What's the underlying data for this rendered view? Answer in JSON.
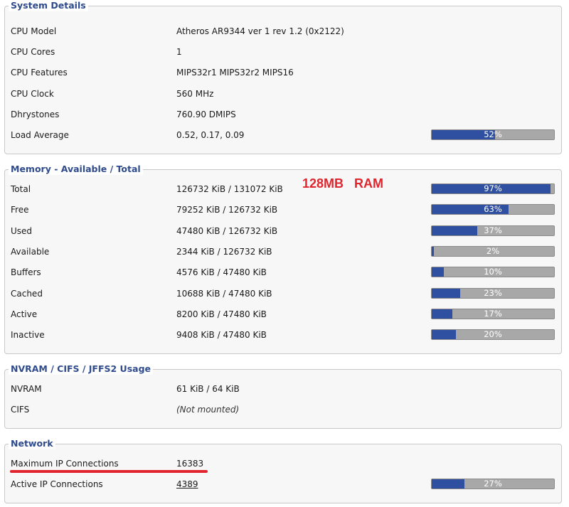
{
  "system": {
    "legend": "System Details",
    "rows": [
      {
        "label": "CPU Model",
        "value": "Atheros AR9344 ver 1 rev 1.2 (0x2122)"
      },
      {
        "label": "CPU Cores",
        "value": "1"
      },
      {
        "label": "CPU Features",
        "value": "MIPS32r1 MIPS32r2 MIPS16"
      },
      {
        "label": "CPU Clock",
        "value": "560 MHz"
      },
      {
        "label": "Dhrystones",
        "value": "760.90 DMIPS"
      },
      {
        "label": "Load Average",
        "value": "0.52, 0.17, 0.09",
        "bar_percent": 52,
        "bar_text": "52%"
      }
    ]
  },
  "memory": {
    "legend": "Memory - Available / Total",
    "annotation": "128MB   RAM",
    "rows": [
      {
        "label": "Total",
        "value": "126732 KiB / 131072 KiB",
        "bar_percent": 97,
        "bar_text": "97%"
      },
      {
        "label": "Free",
        "value": "79252 KiB / 126732 KiB",
        "bar_percent": 63,
        "bar_text": "63%"
      },
      {
        "label": "Used",
        "value": "47480 KiB / 126732 KiB",
        "bar_percent": 37,
        "bar_text": "37%"
      },
      {
        "label": "Available",
        "value": "2344 KiB / 126732 KiB",
        "bar_percent": 2,
        "bar_text": "2%"
      },
      {
        "label": "Buffers",
        "value": "4576 KiB / 47480 KiB",
        "bar_percent": 10,
        "bar_text": "10%"
      },
      {
        "label": "Cached",
        "value": "10688 KiB / 47480 KiB",
        "bar_percent": 23,
        "bar_text": "23%"
      },
      {
        "label": "Active",
        "value": "8200 KiB / 47480 KiB",
        "bar_percent": 17,
        "bar_text": "17%"
      },
      {
        "label": "Inactive",
        "value": "9408 KiB / 47480 KiB",
        "bar_percent": 20,
        "bar_text": "20%"
      }
    ]
  },
  "nvram": {
    "legend": "NVRAM / CIFS / JFFS2 Usage",
    "rows": [
      {
        "label": "NVRAM",
        "value": "61 KiB / 64 KiB"
      },
      {
        "label": "CIFS",
        "value": "(Not mounted)"
      }
    ]
  },
  "network": {
    "legend": "Network",
    "rows": [
      {
        "label": "Maximum IP Connections",
        "value": "16383"
      },
      {
        "label": "Active IP Connections",
        "value": "4389",
        "bar_percent": 27,
        "bar_text": "27%"
      }
    ]
  },
  "colors": {
    "legend_text": "#2f4b8c",
    "bar_fill": "#2f50a0",
    "bar_track": "#a8a8a8",
    "annotation": "#e0252e"
  }
}
